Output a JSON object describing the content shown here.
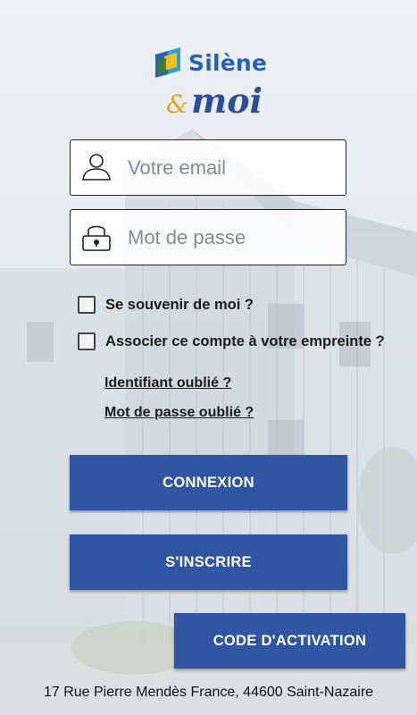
{
  "brand": {
    "name": "Silène",
    "tagline_amp": "&",
    "tagline_word": "moi",
    "colors": {
      "blue": "#2a60b6",
      "orange": "#e6a11b",
      "yellow": "#f2c21a",
      "dark_blue": "#2c4f9b"
    }
  },
  "form": {
    "email": {
      "placeholder": "Votre email",
      "value": "",
      "icon": "user-icon"
    },
    "password": {
      "placeholder": "Mot de passe",
      "value": "",
      "icon": "lock-icon"
    },
    "remember_label": "Se souvenir de moi ?",
    "remember_checked": false,
    "fingerprint_label": "Associer ce compte à votre empreinte ?",
    "fingerprint_checked": false,
    "forgot_id_label": "Identifiant oublié ?",
    "forgot_password_label": "Mot de passe oublié ?"
  },
  "buttons": {
    "connexion": "CONNEXION",
    "inscrire": "S'INSCRIRE",
    "activation": "CODE D'ACTIVATION",
    "color": "#2f55a3"
  },
  "footer": {
    "address": "17 Rue Pierre Mendès France, 44600 Saint-Nazaire"
  }
}
